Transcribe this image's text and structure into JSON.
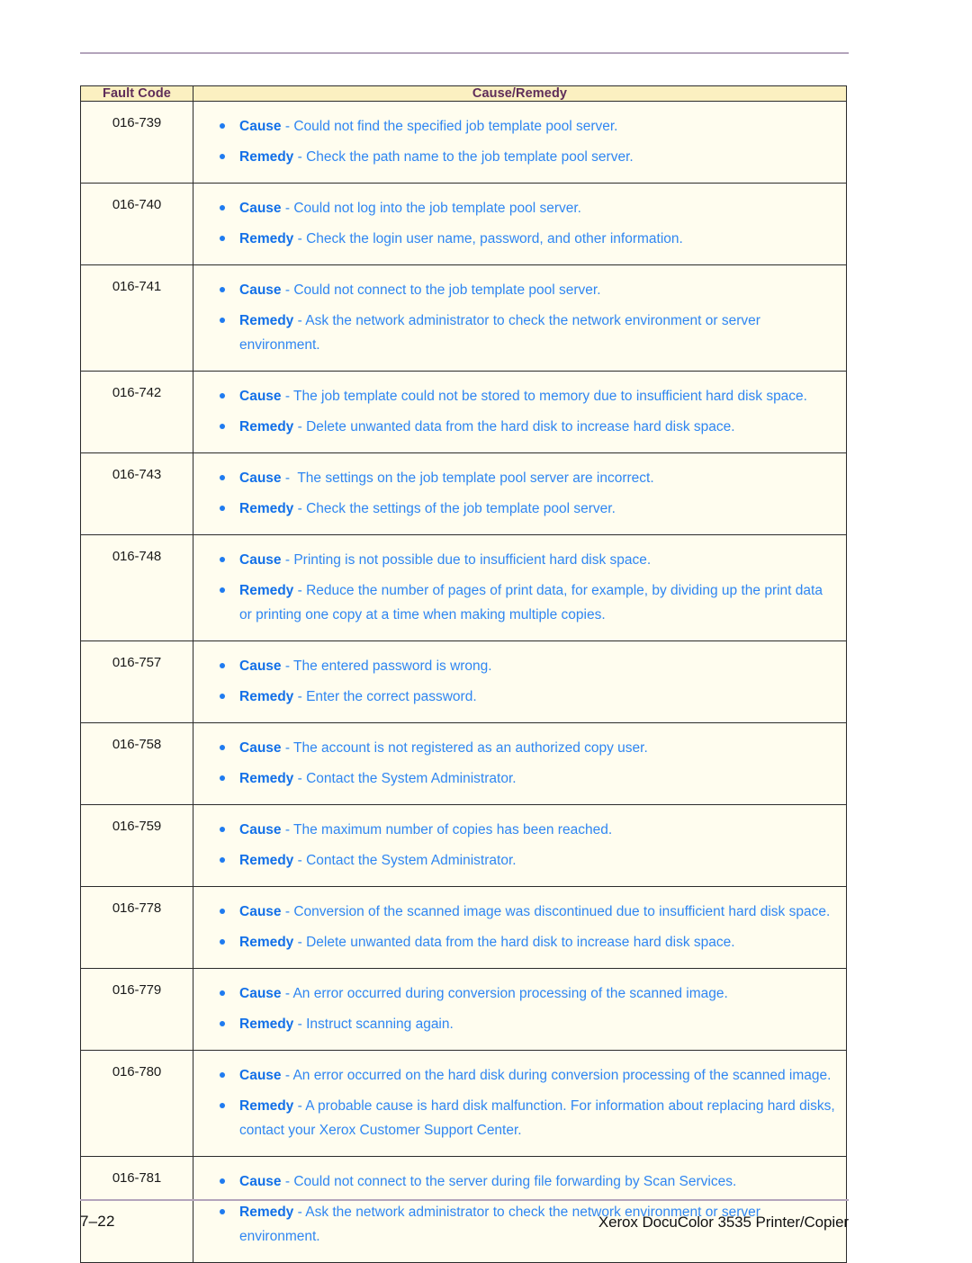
{
  "document": {
    "table": {
      "columns": [
        "Fault Code",
        "Cause/Remedy"
      ],
      "rows": [
        {
          "code": "016-739",
          "items": [
            {
              "label": "Cause",
              "sep": " - ",
              "text": "Could not find the specified job template pool server."
            },
            {
              "label": "Remedy",
              "sep": " - ",
              "text": "Check the path name to the job template pool server."
            }
          ]
        },
        {
          "code": "016-740",
          "items": [
            {
              "label": "Cause",
              "sep": " - ",
              "text": "Could not log into the job template pool server."
            },
            {
              "label": "Remedy",
              "sep": " - ",
              "text": "Check the login user name, password, and other information."
            }
          ]
        },
        {
          "code": "016-741",
          "items": [
            {
              "label": "Cause",
              "sep": " - ",
              "text": "Could not connect to the job template pool server."
            },
            {
              "label": "Remedy",
              "sep": " - ",
              "text": "Ask the network administrator to check the network environment or server environment."
            }
          ]
        },
        {
          "code": "016-742",
          "items": [
            {
              "label": "Cause",
              "sep": " - ",
              "text": "The job template could not be stored to memory due to insufficient hard disk space."
            },
            {
              "label": "Remedy",
              "sep": " - ",
              "text": "Delete unwanted data from the hard disk to increase hard disk space."
            }
          ]
        },
        {
          "code": "016-743",
          "items": [
            {
              "label": "Cause",
              "sep": " -  ",
              "text": "The settings on the job template pool server are incorrect."
            },
            {
              "label": "Remedy",
              "sep": " - ",
              "text": "Check the settings of the job template pool server."
            }
          ]
        },
        {
          "code": "016-748",
          "items": [
            {
              "label": "Cause",
              "sep": " - ",
              "text": "Printing is not possible due to insufficient hard disk space."
            },
            {
              "label": "Remedy",
              "sep": " - ",
              "text": "Reduce the number of pages of print data, for example, by dividing up the print data or printing one copy at a time when making multiple copies."
            }
          ]
        },
        {
          "code": "016-757",
          "items": [
            {
              "label": "Cause",
              "sep": " - ",
              "text": "The entered password is wrong."
            },
            {
              "label": "Remedy",
              "sep": " - ",
              "text": "Enter the correct password."
            }
          ]
        },
        {
          "code": "016-758",
          "items": [
            {
              "label": "Cause",
              "sep": " - ",
              "text": "The account is not registered as an authorized copy user."
            },
            {
              "label": "Remedy",
              "sep": " - ",
              "text": "Contact the System Administrator."
            }
          ]
        },
        {
          "code": "016-759",
          "items": [
            {
              "label": "Cause",
              "sep": " - ",
              "text": "The maximum number of copies has been reached."
            },
            {
              "label": "Remedy",
              "sep": " - ",
              "text": "Contact the System Administrator."
            }
          ]
        },
        {
          "code": "016-778",
          "items": [
            {
              "label": "Cause",
              "sep": " - ",
              "text": "Conversion of the scanned image was discontinued due to insufficient hard disk space."
            },
            {
              "label": "Remedy",
              "sep": " - ",
              "text": "Delete unwanted data from the hard disk to increase hard disk space."
            }
          ]
        },
        {
          "code": "016-779",
          "items": [
            {
              "label": "Cause",
              "sep": " - ",
              "text": "An error occurred during conversion processing of the scanned image."
            },
            {
              "label": "Remedy",
              "sep": " - ",
              "text": "Instruct scanning again."
            }
          ]
        },
        {
          "code": "016-780",
          "items": [
            {
              "label": "Cause",
              "sep": " - ",
              "text": "An error occurred on the hard disk during conversion processing of the scanned image."
            },
            {
              "label": "Remedy",
              "sep": " - ",
              "text": "A probable cause is hard disk malfunction. For information about replacing hard disks, contact your Xerox Customer Support Center."
            }
          ]
        },
        {
          "code": "016-781",
          "items": [
            {
              "label": "Cause",
              "sep": " - ",
              "text": "Could not connect to the server during file forwarding by Scan Services."
            },
            {
              "label": "Remedy",
              "sep": " - ",
              "text": "Ask the network administrator to check the network environment or server environment."
            }
          ]
        }
      ]
    },
    "footer": {
      "page_number": "7–22",
      "book_title": "Xerox DocuColor 3535 Printer/Copier"
    },
    "colors": {
      "header_background": "#fbf0c1",
      "header_text": "#5f2d59",
      "cell_background": "#fffdef",
      "body_text_blue": "#2f86f2",
      "label_blue": "#1370e8",
      "rule": "#b3a4bb",
      "border": "#2b2b2b"
    }
  }
}
